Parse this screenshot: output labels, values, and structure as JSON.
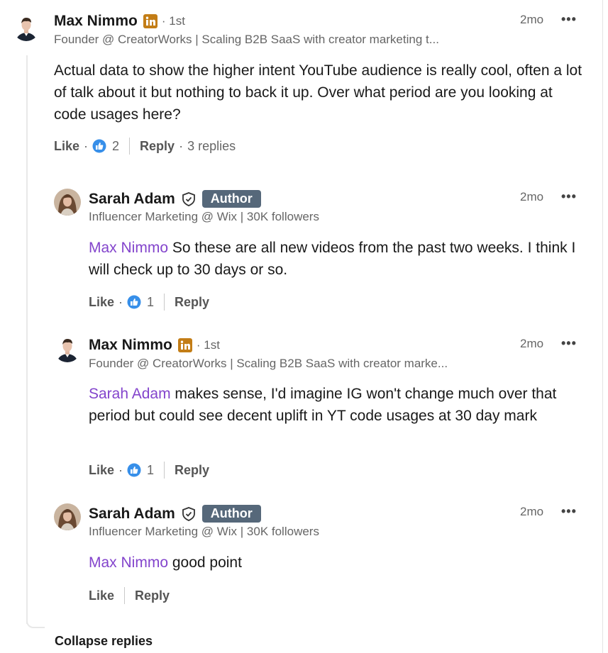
{
  "colors": {
    "mention": "#8344cc",
    "author_badge": "#56687a",
    "linkedin_badge": "#c37d16",
    "like_icon": "#378fe9"
  },
  "comments": [
    {
      "name": "Max Nimmo",
      "degree": "· 1st",
      "headline": "Founder @ CreatorWorks | Scaling B2B SaaS with creator marketing t...",
      "time": "2mo",
      "more": "•••",
      "mention": "",
      "text": "Actual data to show the higher intent YouTube audience is really cool, often a lot of talk about it but nothing to back it up. Over what period are you looking at code usages here?",
      "like_label": "Like",
      "reaction_count": "2",
      "reply_label": "Reply",
      "replies_count": "3 replies"
    },
    {
      "name": "Sarah Adam",
      "badge": "Author",
      "headline": "Influencer Marketing @ Wix | 30K followers",
      "time": "2mo",
      "more": "•••",
      "mention": "Max Nimmo",
      "text": " So these are all new videos from the past two weeks. I think I will check up to 30 days or so.",
      "like_label": "Like",
      "reaction_count": "1",
      "reply_label": "Reply"
    },
    {
      "name": "Max Nimmo",
      "degree": "· 1st",
      "headline": "Founder @ CreatorWorks | Scaling B2B SaaS with creator marke...",
      "time": "2mo",
      "more": "•••",
      "mention": "Sarah Adam",
      "text": " makes sense, I'd imagine IG won't change much over that period but could see decent uplift in YT code usages at 30 day mark",
      "like_label": "Like",
      "reaction_count": "1",
      "reply_label": "Reply"
    },
    {
      "name": "Sarah Adam",
      "badge": "Author",
      "headline": "Influencer Marketing @ Wix | 30K followers",
      "time": "2mo",
      "more": "•••",
      "mention": "Max Nimmo",
      "text": " good point",
      "like_label": "Like",
      "reply_label": "Reply"
    }
  ],
  "collapse_label": "Collapse replies"
}
